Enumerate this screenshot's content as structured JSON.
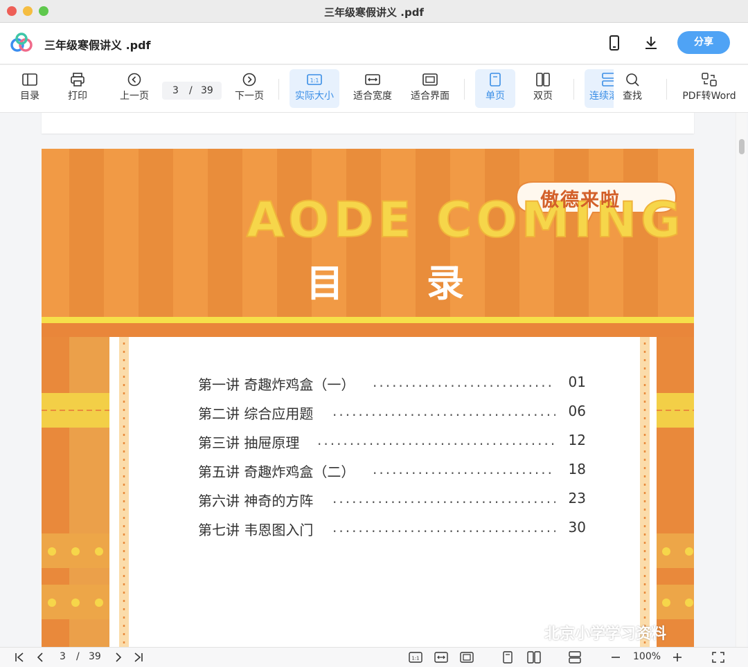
{
  "window": {
    "title": "三年级寒假讲义 .pdf"
  },
  "header": {
    "doc_title": "三年级寒假讲义 .pdf",
    "share_label": "分享"
  },
  "toolbar": {
    "toc_label": "目录",
    "print_label": "打印",
    "prev_label": "上一页",
    "page_current": "3",
    "page_sep": "/",
    "page_total": "39",
    "next_label": "下一页",
    "actual_size_label": "实际大小",
    "fit_width_label": "适合宽度",
    "fit_page_label": "适合界面",
    "single_label": "单页",
    "double_label": "双页",
    "continuous_label": "连续滚",
    "find_label": "查找",
    "pdf_to_word_label": "PDF转Word"
  },
  "document": {
    "banner_en": "AODE COMING",
    "banner_badge": "傲德来啦",
    "toc_title_left": "目",
    "toc_title_right": "录",
    "toc": [
      {
        "label": "第一讲  奇趣炸鸡盒（一）",
        "page": "01"
      },
      {
        "label": "第二讲  综合应用题",
        "page": "06"
      },
      {
        "label": "第三讲  抽屉原理",
        "page": "12"
      },
      {
        "label": "第五讲  奇趣炸鸡盒（二）",
        "page": "18"
      },
      {
        "label": "第六讲  神奇的方阵",
        "page": "23"
      },
      {
        "label": "第七讲  韦恩图入门",
        "page": "30"
      }
    ]
  },
  "bottombar": {
    "page_current": "3",
    "page_sep": "/",
    "page_total": "39",
    "zoom": "100%"
  },
  "watermark": "北京小学学习资料",
  "colors": {
    "accent": "#3a8ee6",
    "share": "#4fa3f5",
    "banner_orange": "#e8893a",
    "banner_yellow": "#f6d64a"
  }
}
